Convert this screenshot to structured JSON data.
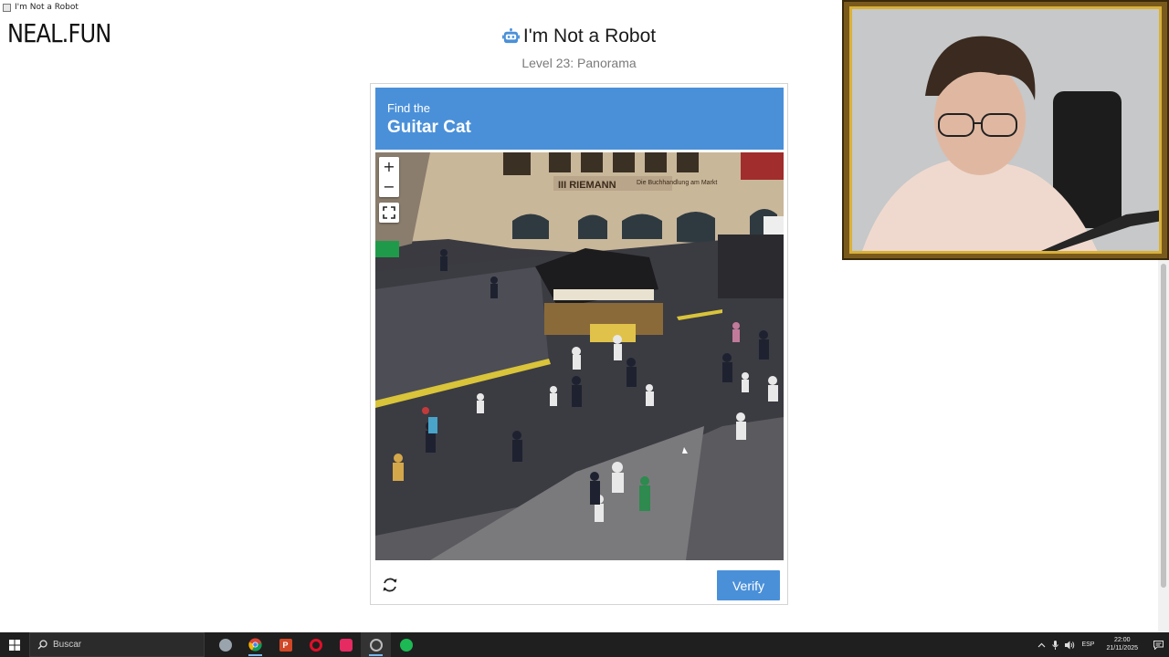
{
  "window": {
    "title": "I'm Not a Robot"
  },
  "site": {
    "logo": "NEAL.FUN"
  },
  "header": {
    "title": "I'm Not a Robot",
    "subtitle": "Level 23: Panorama"
  },
  "captcha": {
    "find_label": "Find the",
    "target": "Guitar Cat",
    "zoom_in": "+",
    "zoom_out": "−",
    "verify_label": "Verify",
    "storefront_sign": "III RIEMANN",
    "storefront_tagline": "Die Buchhandlung am Markt",
    "accent_color": "#4a90d9"
  },
  "taskbar": {
    "search_placeholder": "Buscar",
    "apps": [
      "file-explorer-icon",
      "chrome-icon",
      "powerpoint-icon",
      "opera-icon",
      "tiktok-icon",
      "obs-icon",
      "spotify-icon"
    ],
    "language": "ESP",
    "time": "22:00",
    "date": "21/11/2025"
  }
}
